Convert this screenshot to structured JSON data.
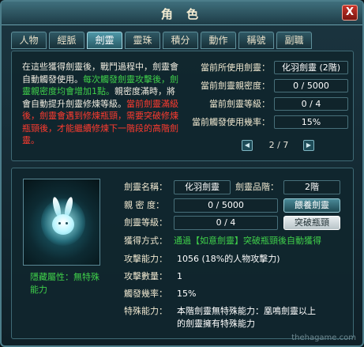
{
  "window": {
    "title": "角 色",
    "close_symbol": "X"
  },
  "tabs": [
    {
      "label": "人物",
      "active": false
    },
    {
      "label": "經脈",
      "active": false
    },
    {
      "label": "劍靈",
      "active": true
    },
    {
      "label": "靈珠",
      "active": false
    },
    {
      "label": "積分",
      "active": false
    },
    {
      "label": "動作",
      "active": false
    },
    {
      "label": "稱號",
      "active": false
    },
    {
      "label": "副職",
      "active": false
    }
  ],
  "description": {
    "white_1": "在這些獲得劍靈後，戰鬥過程中，劍靈會自動觸發使用。",
    "green_1": "每次觸發劍靈攻擊後，劍靈親密度均會增加1點。",
    "white_2": "親密度滿時，將會自動提升劍靈修煉等級。",
    "red_1": "當前劍靈滿級後，劍靈會遇到修煉瓶頸，需要突破修煉瓶頸後，才能繼續修煉下一階段的高階劍靈。"
  },
  "status": {
    "rows": [
      {
        "label": "當前所使用劍靈：",
        "value": "化羽劍靈 (2階)"
      },
      {
        "label": "當前劍靈親密度：",
        "value": "0 / 5000"
      },
      {
        "label": "當前劍靈等級：",
        "value": "0 / 4"
      },
      {
        "label": "當前觸發使用幾率：",
        "value": "15%"
      }
    ],
    "pager": "2 / 7"
  },
  "detail": {
    "name_label": "劍靈名稱：",
    "name_value": "化羽劍靈",
    "grade_label": "劍靈品階：",
    "grade_value": "2階",
    "intimacy_label": "親 密 度：",
    "intimacy_value": "0 / 5000",
    "feed_button": "餵養劍靈",
    "level_label": "劍靈等級：",
    "level_value": "0 / 4",
    "breakthrough_button": "突破瓶頸",
    "obtain_label": "獲得方式：",
    "obtain_value": "通過【如意劍靈】突破瓶頸後自動獲得",
    "attack_label": "攻擊能力：",
    "attack_value": "1056 (18%的人物攻擊力)",
    "count_label": "攻擊數量：",
    "count_value": "1",
    "rate_label": "觸發幾率：",
    "rate_value": "15%",
    "special_label": "特殊能力：",
    "special_value_1": "本階劍靈無特殊能力：凰鳴劍靈以上",
    "special_value_2": "的劍靈擁有特殊能力"
  },
  "hidden_attribute": {
    "line1": "隱藏屬性：無特殊",
    "line2": "能力"
  },
  "watermark": "thehagame.com"
}
